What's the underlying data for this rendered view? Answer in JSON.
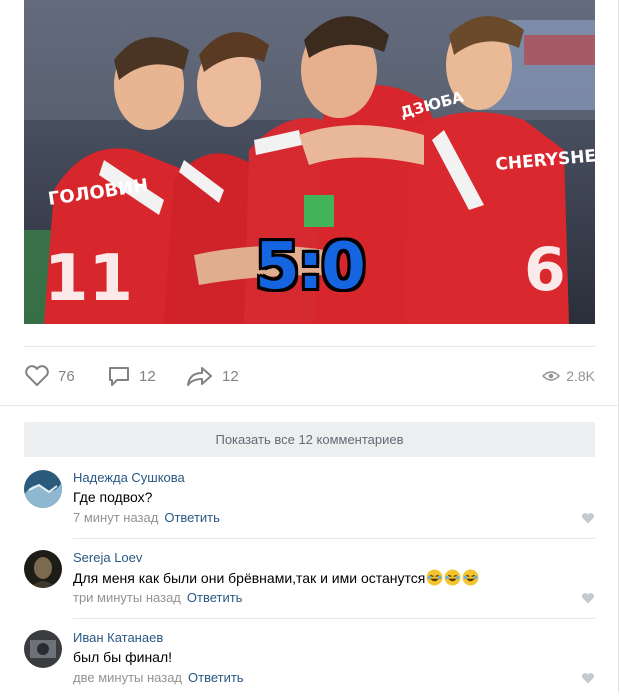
{
  "post": {
    "score_overlay": "5:0",
    "jersey_names": [
      "ГОЛОВИН",
      "ДЗЮБА",
      "CHERYSHEV"
    ],
    "jersey_numbers": [
      "11",
      "6"
    ],
    "colors": {
      "jersey_red": "#d7262c",
      "score_blue": "#1565e0",
      "link_blue": "#2a5885"
    }
  },
  "actions": {
    "likes": "76",
    "comments": "12",
    "shares": "12",
    "views": "2.8K"
  },
  "show_all_label": "Показать все 12 комментариев",
  "reply_label": "Ответить",
  "comments": [
    {
      "author": "Надежда Сушкова",
      "text": "Где подвох?",
      "time": "7 минут назад"
    },
    {
      "author": "Sereja Loev",
      "text": "Для меня как были они брёвнами,так и ими останутся",
      "time": "три минуты назад",
      "emoji": [
        "rofl",
        "rofl",
        "rofl"
      ]
    },
    {
      "author": "Иван Катанаев",
      "text": "был бы финал!",
      "time": "две минуты назад"
    }
  ],
  "icons": [
    "heart-icon",
    "comment-icon",
    "share-icon",
    "eye-icon",
    "like-heart-icon",
    "rofl-emoji-icon"
  ]
}
